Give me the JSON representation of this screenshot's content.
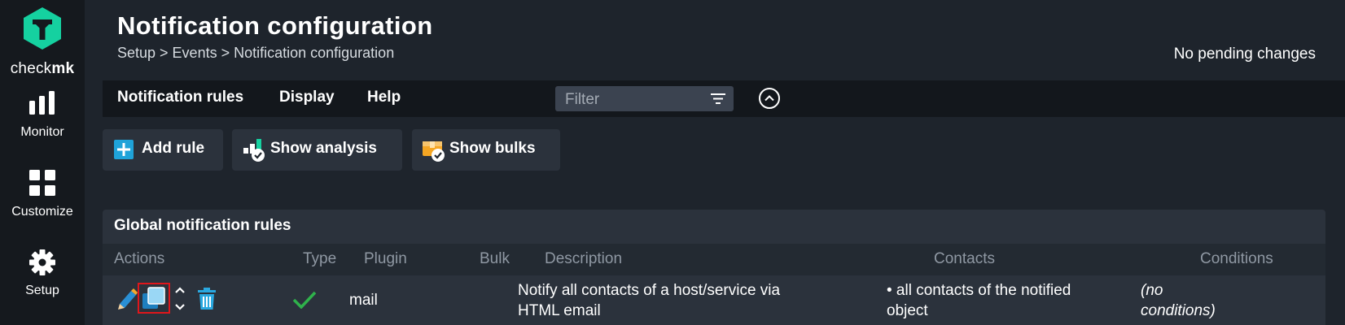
{
  "sidebar": {
    "logo_text_regular": "check",
    "logo_text_bold": "mk",
    "items": [
      {
        "label": "Monitor",
        "icon": "monitor-bars-icon"
      },
      {
        "label": "Customize",
        "icon": "customize-grid-icon"
      },
      {
        "label": "Setup",
        "icon": "gear-icon"
      }
    ]
  },
  "header": {
    "title": "Notification configuration",
    "breadcrumb": "Setup > Events > Notification configuration",
    "pending": "No pending changes"
  },
  "menubar": {
    "items": [
      "Notification rules",
      "Display",
      "Help"
    ],
    "filter_placeholder": "Filter"
  },
  "actions": {
    "add_rule": "Add rule",
    "show_analysis": "Show analysis",
    "show_bulks": "Show bulks"
  },
  "table": {
    "title": "Global notification rules",
    "columns": [
      "Actions",
      "Type",
      "Plugin",
      "Bulk",
      "Description",
      "Contacts",
      "Conditions"
    ],
    "rows": [
      {
        "type_icon": "checkmark-icon",
        "plugin": "mail",
        "bulk": "",
        "description_line1": "Notify all contacts of a host/service via",
        "description_line2": "HTML email",
        "contacts_line1": "• all contacts of the notified",
        "contacts_line2": "object",
        "conditions_line1": "(no",
        "conditions_line2": "conditions)"
      }
    ]
  },
  "colors": {
    "brand_green": "#15d1a0",
    "sidebar_bg": "#15191e",
    "page_bg": "#1e242c",
    "highlight_red": "#e0161b"
  }
}
